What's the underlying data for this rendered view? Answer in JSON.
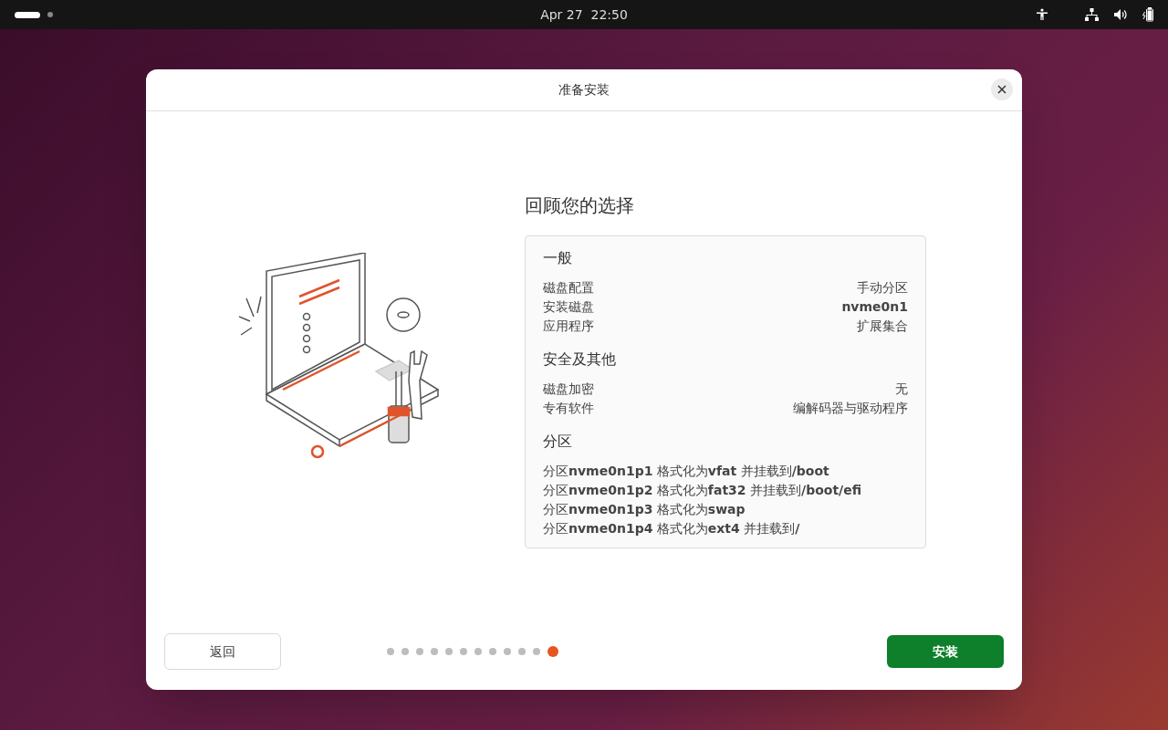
{
  "top_bar": {
    "clock": "Apr 27  22:50"
  },
  "window": {
    "title": "准备安装"
  },
  "review": {
    "heading": "回顾您的选择",
    "sections": [
      {
        "kind": "pairs",
        "title": "一般",
        "rows": [
          {
            "label": "磁盘配置",
            "value": "手动分区",
            "bold": false
          },
          {
            "label": "安装磁盘",
            "value": "nvme0n1",
            "bold": true
          },
          {
            "label": "应用程序",
            "value": "扩展集合",
            "bold": false
          }
        ]
      },
      {
        "kind": "pairs",
        "title": "安全及其他",
        "rows": [
          {
            "label": "磁盘加密",
            "value": "无",
            "bold": false
          },
          {
            "label": "专有软件",
            "value": "编解码器与驱动程序",
            "bold": false
          }
        ]
      },
      {
        "kind": "lines",
        "title": "分区",
        "lines": [
          "分区**nvme0n1p1** 格式化为**vfat** 并挂载到**/boot**",
          "分区**nvme0n1p2** 格式化为**fat32** 并挂载到**/boot/efi**",
          "分区**nvme0n1p3** 格式化为**swap**",
          "分区**nvme0n1p4** 格式化为**ext4** 并挂载到**/**"
        ]
      }
    ]
  },
  "footer": {
    "back": "返回",
    "install": "安装",
    "steps": [
      {
        "selected": false
      },
      {
        "selected": false
      },
      {
        "selected": false
      },
      {
        "selected": false
      },
      {
        "selected": false
      },
      {
        "selected": false
      },
      {
        "selected": false
      },
      {
        "selected": false
      },
      {
        "selected": false
      },
      {
        "selected": false
      },
      {
        "selected": false
      },
      {
        "selected": true
      }
    ]
  }
}
